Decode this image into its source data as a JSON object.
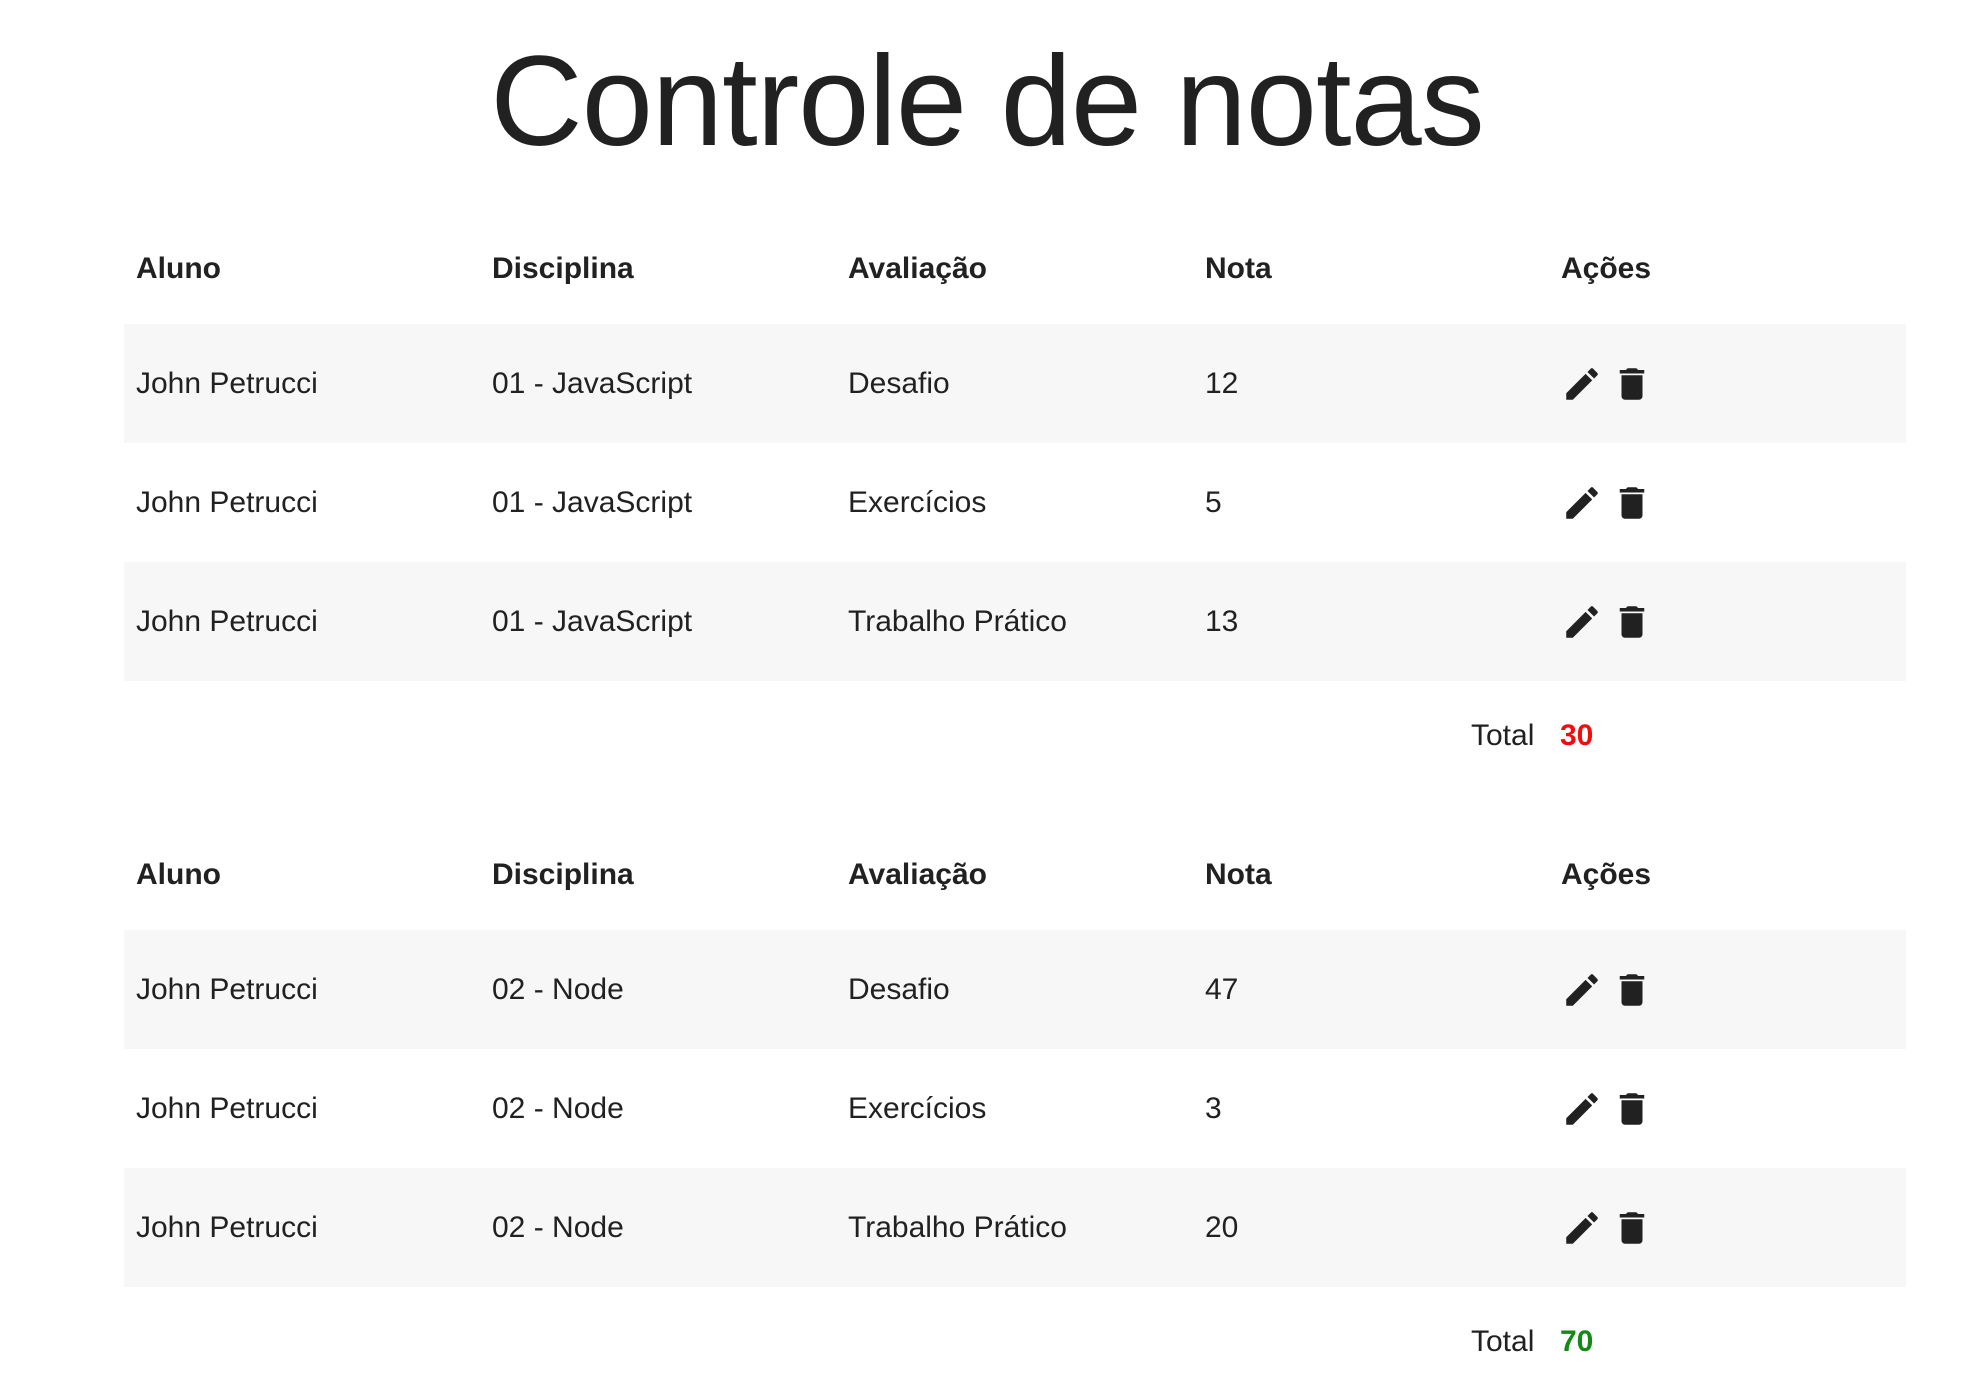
{
  "page": {
    "title": "Controle de notas"
  },
  "columns": [
    "Aluno",
    "Disciplina",
    "Avaliação",
    "Nota",
    "Ações"
  ],
  "tables": [
    {
      "rows": [
        {
          "aluno": "John Petrucci",
          "disciplina": "01 - JavaScript",
          "avaliacao": "Desafio",
          "nota": "12"
        },
        {
          "aluno": "John Petrucci",
          "disciplina": "01 - JavaScript",
          "avaliacao": "Exercícios",
          "nota": "5"
        },
        {
          "aluno": "John Petrucci",
          "disciplina": "01 - JavaScript",
          "avaliacao": "Trabalho Prático",
          "nota": "13"
        }
      ],
      "total_label": "Total",
      "total_value": "30",
      "total_color": "#f20d0d"
    },
    {
      "rows": [
        {
          "aluno": "John Petrucci",
          "disciplina": "02 - Node",
          "avaliacao": "Desafio",
          "nota": "47"
        },
        {
          "aluno": "John Petrucci",
          "disciplina": "02 - Node",
          "avaliacao": "Exercícios",
          "nota": "3"
        },
        {
          "aluno": "John Petrucci",
          "disciplina": "02 - Node",
          "avaliacao": "Trabalho Prático",
          "nota": "20"
        }
      ],
      "total_label": "Total",
      "total_value": "70",
      "total_color": "#148a14"
    }
  ],
  "icons": {
    "edit": "pencil-icon",
    "delete": "trash-icon"
  }
}
